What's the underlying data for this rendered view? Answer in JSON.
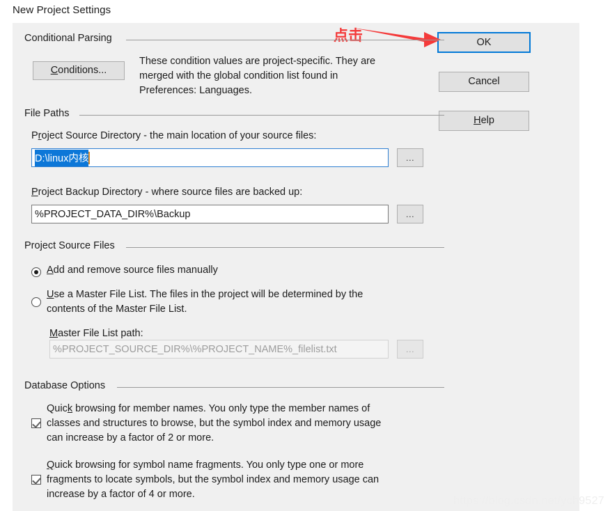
{
  "window": {
    "title": "New Project Settings"
  },
  "buttons": {
    "ok": "OK",
    "cancel": "Cancel",
    "help_prefix": "H",
    "help_rest": "elp",
    "browse": "..."
  },
  "conditional_parsing": {
    "group_label": "Conditional Parsing",
    "conditions_button_prefix": "C",
    "conditions_button_rest": "onditions...",
    "description": "These condition values are project-specific.  They are\nmerged with the global condition list found in\nPreferences: Languages."
  },
  "file_paths": {
    "group_label": "File Paths",
    "source_dir": {
      "label_pre": "P",
      "label_accel": "r",
      "label_post": "oject Source Directory - the main location of your source files:",
      "value_selected": "D:\\linux内核",
      "browse": "..."
    },
    "backup_dir": {
      "label_pre": "",
      "label_accel": "P",
      "label_post": "roject Backup Directory - where source files are backed up:",
      "value": "%PROJECT_DATA_DIR%\\Backup",
      "browse": "..."
    }
  },
  "project_source_files": {
    "group_label": "Project Source Files",
    "option_manual": {
      "accel": "A",
      "rest": "dd and remove source files manually",
      "selected": true
    },
    "option_master_list": {
      "accel": "U",
      "rest": "se a Master File List. The files in the project will be determined by the\ncontents of the Master File List.",
      "selected": false
    },
    "master_path_label_accel": "M",
    "master_path_label_rest": "aster File List path:",
    "master_path_value": "%PROJECT_SOURCE_DIR%\\%PROJECT_NAME%_filelist.txt",
    "master_path_browse": "...",
    "master_path_disabled": true
  },
  "database_options": {
    "group_label": "Database Options",
    "quick_member_names": {
      "checked": true,
      "accel_head": "Quic",
      "accel": "k",
      "rest": " browsing for member names.  You only type the member names of\nclasses and structures to browse, but the symbol index and memory usage\ncan increase by a factor of 2 or more."
    },
    "quick_symbol_fragments": {
      "checked": true,
      "accel": "Q",
      "rest": "uick browsing for symbol name fragments.  You only type one or more\nfragments to locate symbols, but the symbol index and memory usage can\nincrease by a factor of 4 or more."
    }
  },
  "annotation": {
    "text": "点击",
    "color": "#f43a3a"
  },
  "watermark": {
    "text": "https://blog.csdn.net/ych9527"
  },
  "colors": {
    "dialog_bg": "#f0f0f0",
    "focus_blue": "#0078d7",
    "selection_blue": "#0c77d8",
    "button_face": "#e1e1e1",
    "annotation_red": "#f43a3a"
  }
}
